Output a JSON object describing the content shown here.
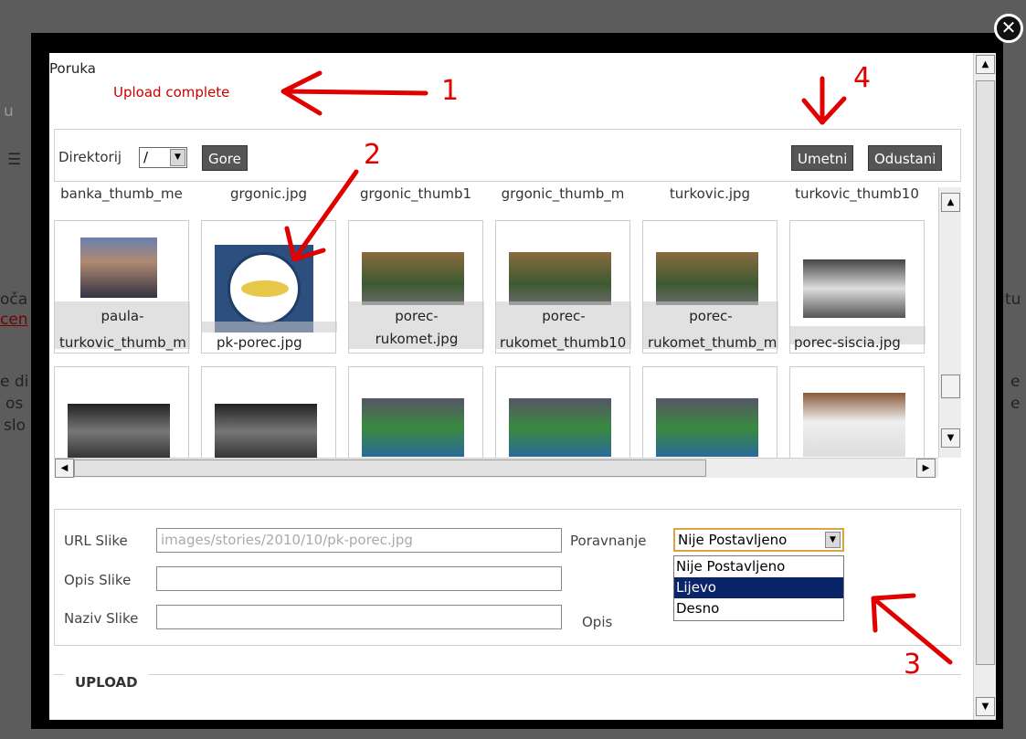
{
  "background": {
    "fragments": [
      "u",
      "☰",
      "oča",
      "cen",
      "e di",
      "os",
      "slo",
      "tu",
      "e",
      "e"
    ]
  },
  "modal": {
    "close_icon": "close-icon",
    "message_label": "Poruka",
    "message_text": "Upload complete",
    "toolbar": {
      "dir_label": "Direktorij",
      "dir_value": "/",
      "up_button": "Gore",
      "insert_button": "Umetni",
      "cancel_button": "Odustani"
    },
    "grid": {
      "top_row_labels": [
        "banka_thumb_me",
        "grgonic.jpg",
        "grgonic_thumb1",
        "grgonic_thumb_m",
        "turkovic.jpg",
        "turkovic_thumb10"
      ],
      "row1": [
        {
          "line1": "paula-",
          "line2": "turkovic_thumb_m"
        },
        {
          "line1": "",
          "line2": "pk-porec.jpg"
        },
        {
          "line1": "porec-",
          "line2": "rukomet.jpg"
        },
        {
          "line1": "porec-",
          "line2": "rukomet_thumb10"
        },
        {
          "line1": "porec-",
          "line2": "rukomet_thumb_m"
        },
        {
          "line1": "",
          "line2": "porec-siscia.jpg"
        }
      ]
    },
    "form": {
      "url_label": "URL Slike",
      "url_value": "images/stories/2010/10/pk-porec.jpg",
      "desc_label": "Opis Slike",
      "desc_value": "",
      "title_label": "Naziv Slike",
      "title_value": "",
      "align_label": "Poravnanje",
      "align_value": "Nije Postavljeno",
      "align_options": [
        "Nije Postavljeno",
        "Lijevo",
        "Desno"
      ],
      "align_selected_index": 1,
      "caption_label": "Opis"
    },
    "upload_title": "UPLOAD"
  },
  "annotations": [
    "1",
    "2",
    "3",
    "4"
  ],
  "colors": {
    "annotation": "#e00000",
    "message": "#cc0000",
    "selected_option": "#0a246a",
    "button": "#555555"
  }
}
